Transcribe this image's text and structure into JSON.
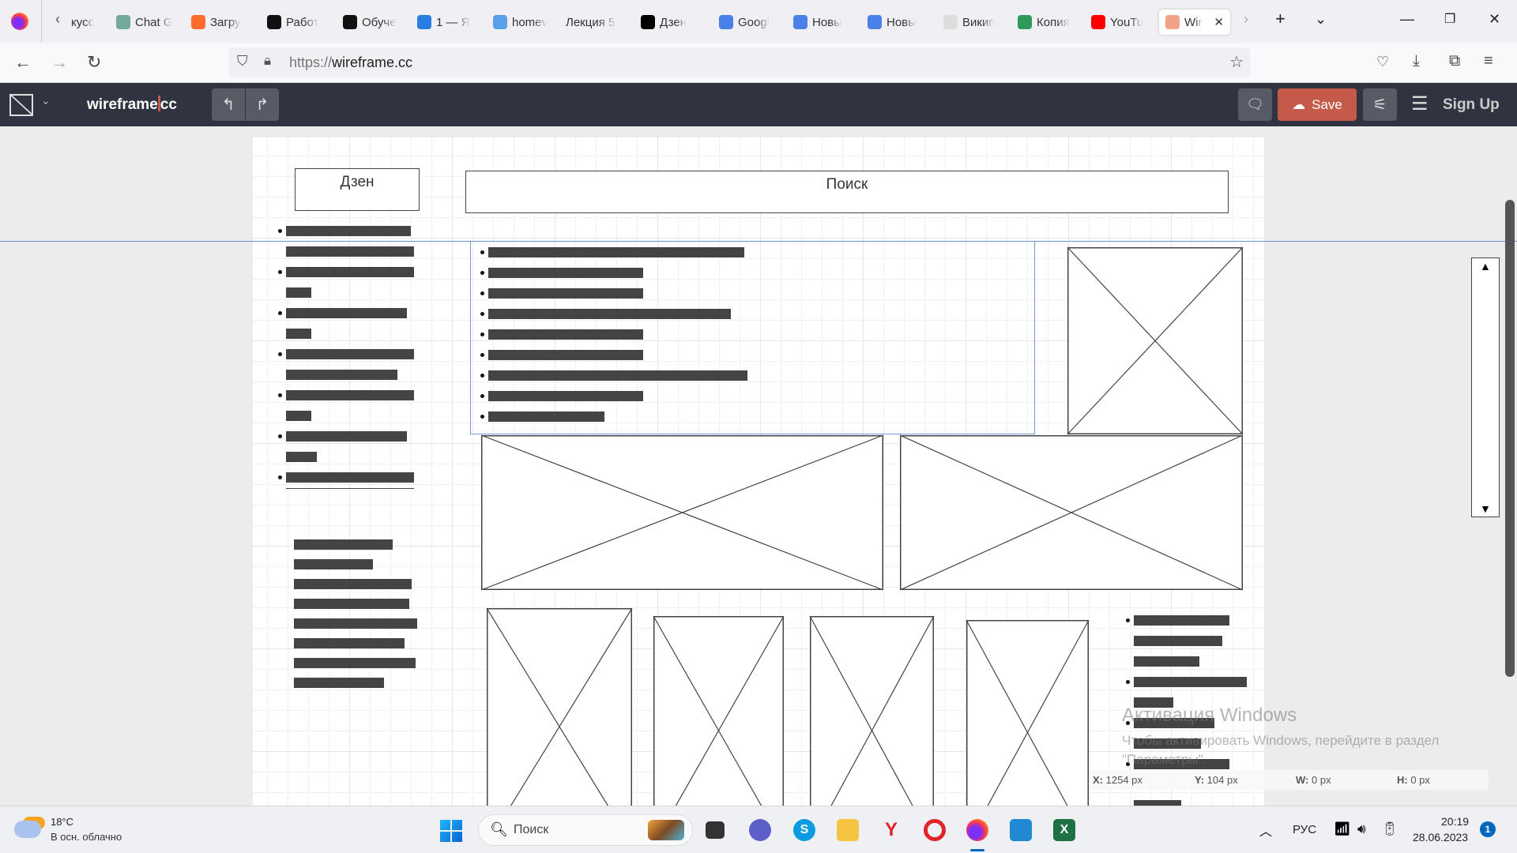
{
  "browser": {
    "tabs": [
      {
        "label": "кусс",
        "icon": "generic"
      },
      {
        "label": "Chat G",
        "icon": "chatgpt-icon"
      },
      {
        "label": "Загру",
        "icon": "firefox-icon"
      },
      {
        "label": "Работ",
        "icon": "openai-icon"
      },
      {
        "label": "Обуче",
        "icon": "openai-icon"
      },
      {
        "label": "1 — Я",
        "icon": "feather-icon"
      },
      {
        "label": "homev",
        "icon": "doc-icon"
      },
      {
        "label": "Лекция 5.",
        "icon": "none"
      },
      {
        "label": "Дзен",
        "icon": "dzen-icon"
      },
      {
        "label": "Googl",
        "icon": "gdocs-icon"
      },
      {
        "label": "Новы",
        "icon": "gdocs-icon"
      },
      {
        "label": "Новы",
        "icon": "gdocs-icon"
      },
      {
        "label": "Викип",
        "icon": "wikipedia-icon"
      },
      {
        "label": "Копия",
        "icon": "gsheets-icon"
      },
      {
        "label": "YouTu",
        "icon": "youtube-icon"
      },
      {
        "label": "Wir",
        "icon": "wireframe-icon",
        "active": true
      }
    ],
    "url_scheme": "https://",
    "url_host": "wireframe.cc"
  },
  "app": {
    "logo_left": "wireframe",
    "logo_right": "cc",
    "save_label": "Save",
    "signup_label": "Sign Up",
    "accent": "#c65a4a"
  },
  "canvas": {
    "header_left": "Дзен",
    "header_search": "Поиск",
    "scroll_up": "▲",
    "scroll_down": "▼"
  },
  "status": {
    "x_label": "X:",
    "x_value": "1254 px",
    "y_label": "Y:",
    "y_value": "104 px",
    "w_label": "W:",
    "w_value": "0 px",
    "h_label": "H:",
    "h_value": "0 px"
  },
  "watermark": {
    "title": "Активация Windows",
    "text": "Чтобы активировать Windows, перейдите в раздел",
    "text2": "\"Параметры\"."
  },
  "taskbar": {
    "weather_temp": "18°C",
    "weather_desc": "В осн. облачно",
    "search_placeholder": "Поиск",
    "lang": "РУС",
    "time": "20:19",
    "date": "28.06.2023",
    "notifications": "1"
  }
}
